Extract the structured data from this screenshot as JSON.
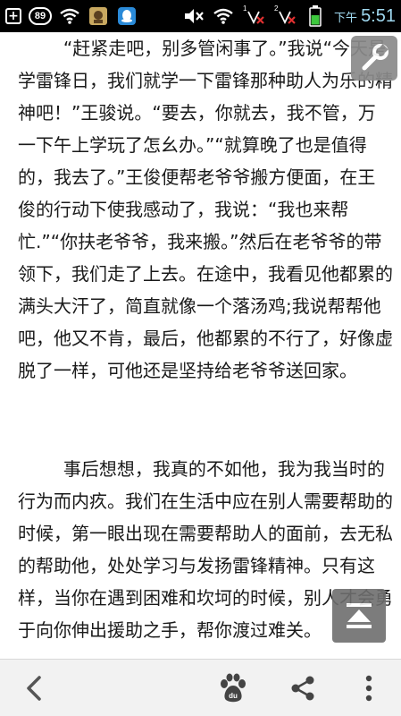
{
  "status_bar": {
    "notification_count": "89",
    "sim1_label": "1",
    "sim2_label": "2",
    "ampm": "下午",
    "time": "5:51"
  },
  "article": {
    "paragraphs": [
      "        “赶紧走吧，别多管闲事了。”我说“今天是学雷锋日，我们就学一下雷锋那种助人为乐的精神吧！”王骏说。“要去，你就去，我不管，万一下午上学玩了怎幺办。”“就算晚了也是值得的，我去了。”王俊便帮老爷爷搬方便面，在王俊的行动下使我感动了，我说：“我也来帮忙.”“你扶老爷爷，我来搬。”然后在老爷爷的带领下，我们走了上去。在途中，我看见他都累的满头大汗了，简直就像一个落汤鸡;我说帮帮他吧，他又不肯，最后，他都累的不行了，好像虚脱了一样，可他还是坚持给老爷爷送回家。",
      "        事后想想，我真的不如他，我为我当时的行为而内疚。我们在生活中应在别人需要帮助的时候，第一眼出现在需要帮助人的面前，去无私的帮助他，处处学习与发扬雷锋精神。只有这样，当你在遇到困难和坎坷的时候，别人才会勇于向你伸出援助之手，帮你渡过难关。"
    ]
  },
  "icons": {
    "tools": "wrench-icon",
    "scroll_top": "scroll-to-top-icon",
    "back": "back-chevron-icon",
    "baidu": "baidu-paw-icon",
    "share": "share-icon",
    "more": "more-vertical-icon"
  },
  "colors": {
    "status_bar_bg": "#000000",
    "clock": "#9fd8ef",
    "text": "#1a1a1a",
    "bottom_bar_bg": "#f2f2f2"
  }
}
